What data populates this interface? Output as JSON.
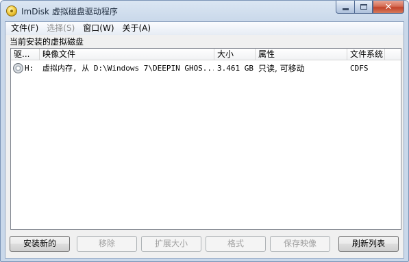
{
  "window": {
    "title": "ImDisk 虚拟磁盘驱动程序"
  },
  "menu": {
    "items": [
      {
        "label": "文件(F)",
        "enabled": true
      },
      {
        "label": "选择(S)",
        "enabled": false
      },
      {
        "label": "窗口(W)",
        "enabled": true
      },
      {
        "label": "关于(A)",
        "enabled": true
      }
    ]
  },
  "section_label": "当前安装的虚拟磁盘",
  "list": {
    "columns": [
      "驱...",
      "映像文件",
      "大小",
      "属性",
      "文件系统"
    ],
    "rows": [
      {
        "drive": "H:",
        "image": "虚拟内存, 从 D:\\Windows 7\\DEEPIN GHOS...",
        "size": "3.461 GB",
        "attributes": "只读, 可移动",
        "filesystem": "CDFS",
        "icon": "disk-drive-icon"
      }
    ]
  },
  "buttons": {
    "install_new": "安装新的",
    "remove": "移除",
    "extend_size": "扩展大小",
    "format": "格式",
    "save_image": "保存映像",
    "refresh_list": "刷新列表"
  },
  "icons": {
    "app": "imdisk-app-icon",
    "minimize": "minimize-icon",
    "maximize": "maximize-icon",
    "close": "close-icon"
  },
  "colors": {
    "titlebar": "#c9d8ea",
    "close_button": "#c2432a",
    "client_background": "#f0f0f0"
  }
}
